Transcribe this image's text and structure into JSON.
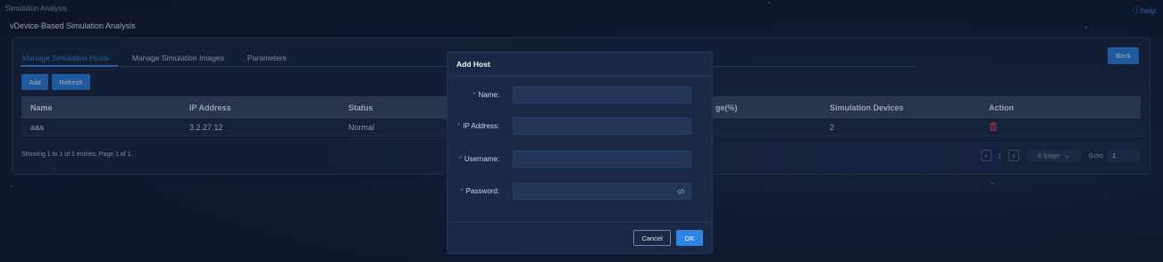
{
  "app": {
    "title": "Simulation Analysis",
    "help_label": "help",
    "subtitle": "vDevice-Based Simulation Analysis"
  },
  "tabs": [
    {
      "label": "Manage Simulation Hosts",
      "active": true
    },
    {
      "label": "Manage Simulation Images",
      "active": false
    },
    {
      "label": "Parameters",
      "active": false
    }
  ],
  "toolbar": {
    "back_label": "Back",
    "add_label": "Add",
    "refresh_label": "Refresh"
  },
  "table": {
    "headers": [
      "Name",
      "IP Address",
      "Status",
      "ge(%)",
      "Simulation Devices",
      "Action"
    ],
    "rows": [
      {
        "name": "aaa",
        "ip": "3.2.27.12",
        "status": "Normal",
        "devices": "2"
      }
    ]
  },
  "pagination": {
    "info": "Showing 1 to 1 of 1 entries. Page 1 of 1.",
    "current_page": "1",
    "page_size": "8 /page",
    "goto_label": "Goto",
    "goto_value": "1"
  },
  "modal": {
    "title": "Add Host",
    "fields": [
      {
        "label": "Name:",
        "value": ""
      },
      {
        "label": "IP Address:",
        "value": ""
      },
      {
        "label": "Username:",
        "value": ""
      },
      {
        "label": "Password:",
        "value": ""
      }
    ],
    "required_mark": "*",
    "cancel_label": "Cancel",
    "ok_label": "OK"
  },
  "colors": {
    "accent": "#2f86e6",
    "active_tab": "#3b8ef0",
    "required": "#e2495a",
    "delete_icon": "#e2495a"
  },
  "icons": {
    "help": "help-circle-icon",
    "delete": "trash-icon",
    "password": "eye-off-icon",
    "prev": "chevron-left-icon",
    "next": "chevron-right-icon",
    "dropdown": "chevron-down-icon"
  }
}
